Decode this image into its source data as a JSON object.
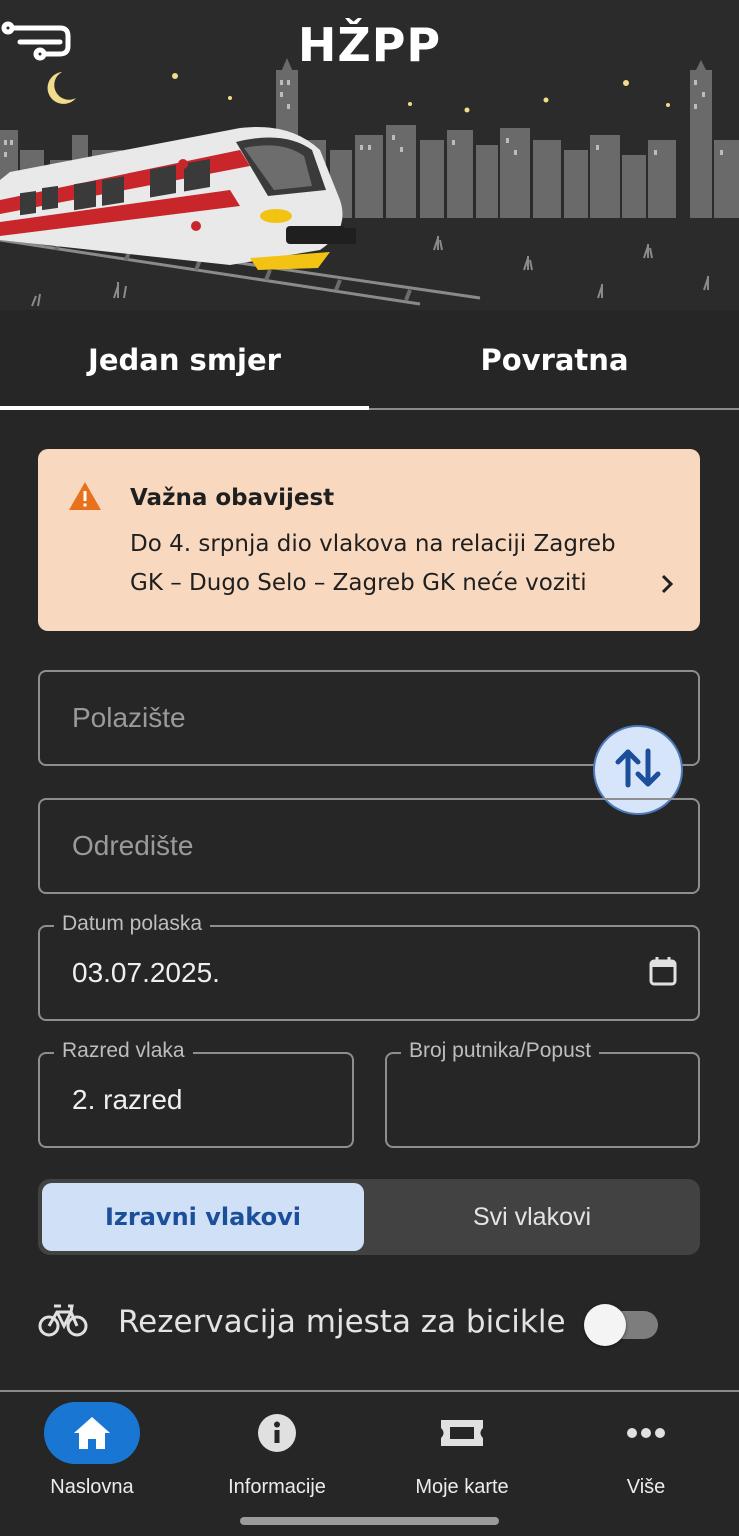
{
  "header": {
    "logo_text": "HŽPP"
  },
  "tabs": [
    {
      "label": "Jedan smjer",
      "active": true
    },
    {
      "label": "Povratna",
      "active": false
    }
  ],
  "notice": {
    "title": "Važna obavijest",
    "body": "Do 4. srpnja dio vlakova na relaciji Zagreb GK – Dugo Selo – Zagreb GK neće voziti",
    "icon": "warning-icon",
    "background": "#f8d9c0"
  },
  "form": {
    "from_placeholder": "Polazište",
    "to_placeholder": "Odredište",
    "date_label": "Datum polaska",
    "date_value": "03.07.2025.",
    "class_label": "Razred vlaka",
    "class_value": "2. razred",
    "passengers_label": "Broj putnika/Popust",
    "passengers_value": ""
  },
  "train_filter": {
    "options": [
      "Izravni vlakovi",
      "Svi vlakovi"
    ],
    "selected": "Izravni vlakovi"
  },
  "bike_reservation": {
    "label": "Rezervacija mjesta za bicikle",
    "enabled": false
  },
  "bottom_nav": [
    {
      "label": "Naslovna",
      "icon": "home-icon",
      "active": true
    },
    {
      "label": "Informacije",
      "icon": "info-icon",
      "active": false
    },
    {
      "label": "Moje karte",
      "icon": "ticket-icon",
      "active": false
    },
    {
      "label": "Više",
      "icon": "more-icon",
      "active": false
    }
  ],
  "colors": {
    "background": "#262626",
    "accent": "#1976d2",
    "segment_active": "#cfe0f7",
    "warning": "#e8711c"
  }
}
